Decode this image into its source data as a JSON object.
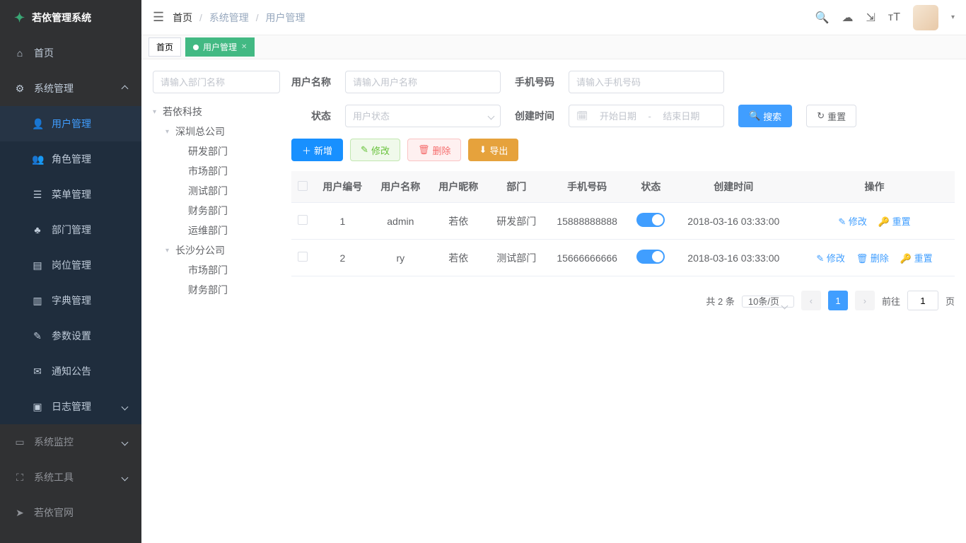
{
  "app_title": "若依管理系统",
  "breadcrumb": {
    "home": "首页",
    "sys": "系统管理",
    "user": "用户管理"
  },
  "tabs": {
    "home": "首页",
    "user": "用户管理"
  },
  "sidebar": {
    "home": "首页",
    "sys": "系统管理",
    "user": "用户管理",
    "role": "角色管理",
    "menu": "菜单管理",
    "dept": "部门管理",
    "post": "岗位管理",
    "dict": "字典管理",
    "param": "参数设置",
    "notice": "通知公告",
    "log": "日志管理",
    "monitor": "系统监控",
    "tool": "系统工具",
    "site": "若依官网"
  },
  "tree_search_placeholder": "请输入部门名称",
  "tree": {
    "root": "若依科技",
    "sz": "深圳总公司",
    "sz_dev": "研发部门",
    "sz_mkt": "市场部门",
    "sz_test": "测试部门",
    "sz_fin": "财务部门",
    "sz_ops": "运维部门",
    "cs": "长沙分公司",
    "cs_mkt": "市场部门",
    "cs_fin": "财务部门"
  },
  "filter": {
    "username_label": "用户名称",
    "username_placeholder": "请输入用户名称",
    "phone_label": "手机号码",
    "phone_placeholder": "请输入手机号码",
    "status_label": "状态",
    "status_placeholder": "用户状态",
    "time_label": "创建时间",
    "start_placeholder": "开始日期",
    "end_placeholder": "结束日期",
    "date_sep": "-",
    "search": "搜索",
    "reset": "重置"
  },
  "actions": {
    "add": "新增",
    "edit": "修改",
    "delete": "删除",
    "export": "导出"
  },
  "table": {
    "headers": {
      "id": "用户编号",
      "name": "用户名称",
      "nick": "用户昵称",
      "dept": "部门",
      "phone": "手机号码",
      "status": "状态",
      "created": "创建时间",
      "op": "操作"
    },
    "rows": [
      {
        "id": "1",
        "name": "admin",
        "nick": "若依",
        "dept": "研发部门",
        "phone": "15888888888",
        "created": "2018-03-16 03:33:00"
      },
      {
        "id": "2",
        "name": "ry",
        "nick": "若依",
        "dept": "测试部门",
        "phone": "15666666666",
        "created": "2018-03-16 03:33:00"
      }
    ],
    "op_edit": "修改",
    "op_delete": "删除",
    "op_reset": "重置"
  },
  "pagination": {
    "total": "共 2 条",
    "page_size": "10条/页",
    "current": "1",
    "goto_prefix": "前往",
    "goto_suffix": "页",
    "goto_value": "1"
  }
}
